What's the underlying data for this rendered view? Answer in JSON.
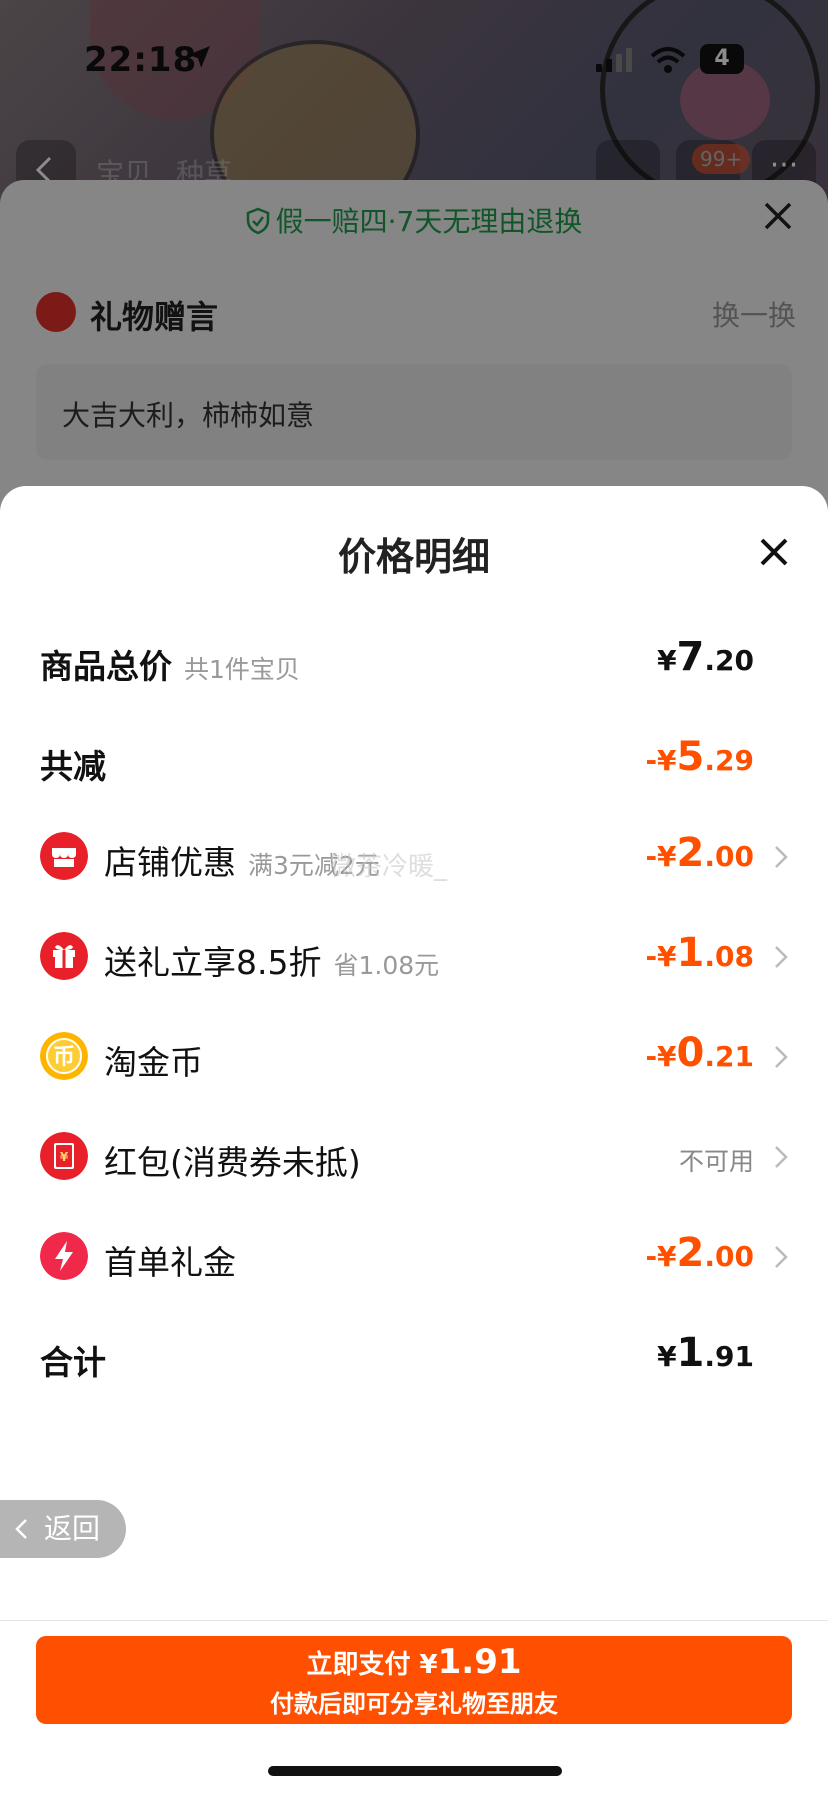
{
  "status_bar": {
    "time": "22:18",
    "battery": "4"
  },
  "product_nav": {
    "tab1": "宝贝",
    "tab2": "种草",
    "badge": "99+",
    "more": "···"
  },
  "gift_sheet": {
    "guarantee": "假一赔四·7天无理由退换",
    "title": "礼物赠言",
    "swap": "换一换",
    "message": "大吉大利，柿柿如意"
  },
  "price_detail": {
    "title": "价格明细",
    "total": {
      "label": "商品总价",
      "sub": "共1件宝贝",
      "currency": "¥",
      "int": "7",
      "dec": ".20"
    },
    "reduction": {
      "label": "共减",
      "currency": "-¥",
      "int": "5",
      "dec": ".29"
    },
    "items": [
      {
        "label": "店铺优惠",
        "sub": "满3元减2元",
        "currency": "-¥",
        "int": "2",
        "dec": ".00",
        "icon": "store-icon"
      },
      {
        "label": "送礼立享8.5折",
        "sub": "省1.08元",
        "currency": "-¥",
        "int": "1",
        "dec": ".08",
        "icon": "gift-icon"
      },
      {
        "label": "淘金币",
        "sub": "",
        "currency": "-¥",
        "int": "0",
        "dec": ".21",
        "icon": "coin-icon"
      },
      {
        "label": "红包(消费券未抵)",
        "sub": "",
        "status": "不可用",
        "icon": "red-packet-icon"
      },
      {
        "label": "首单礼金",
        "sub": "",
        "currency": "-¥",
        "int": "2",
        "dec": ".00",
        "icon": "lightning-icon"
      }
    ],
    "sum": {
      "label": "合计",
      "currency": "¥",
      "int": "1",
      "dec": ".91"
    },
    "watermark": "微茶冷暖_"
  },
  "back_pill": {
    "label": "返回"
  },
  "pay_button": {
    "line1": "立即支付",
    "currency": "¥",
    "amount": "1.91",
    "line2": "付款后即可分享礼物至朋友"
  },
  "colors": {
    "accent": "#ff5000",
    "pay": "#ff4f00",
    "green": "#1f9d4b",
    "red": "#e0302a"
  }
}
